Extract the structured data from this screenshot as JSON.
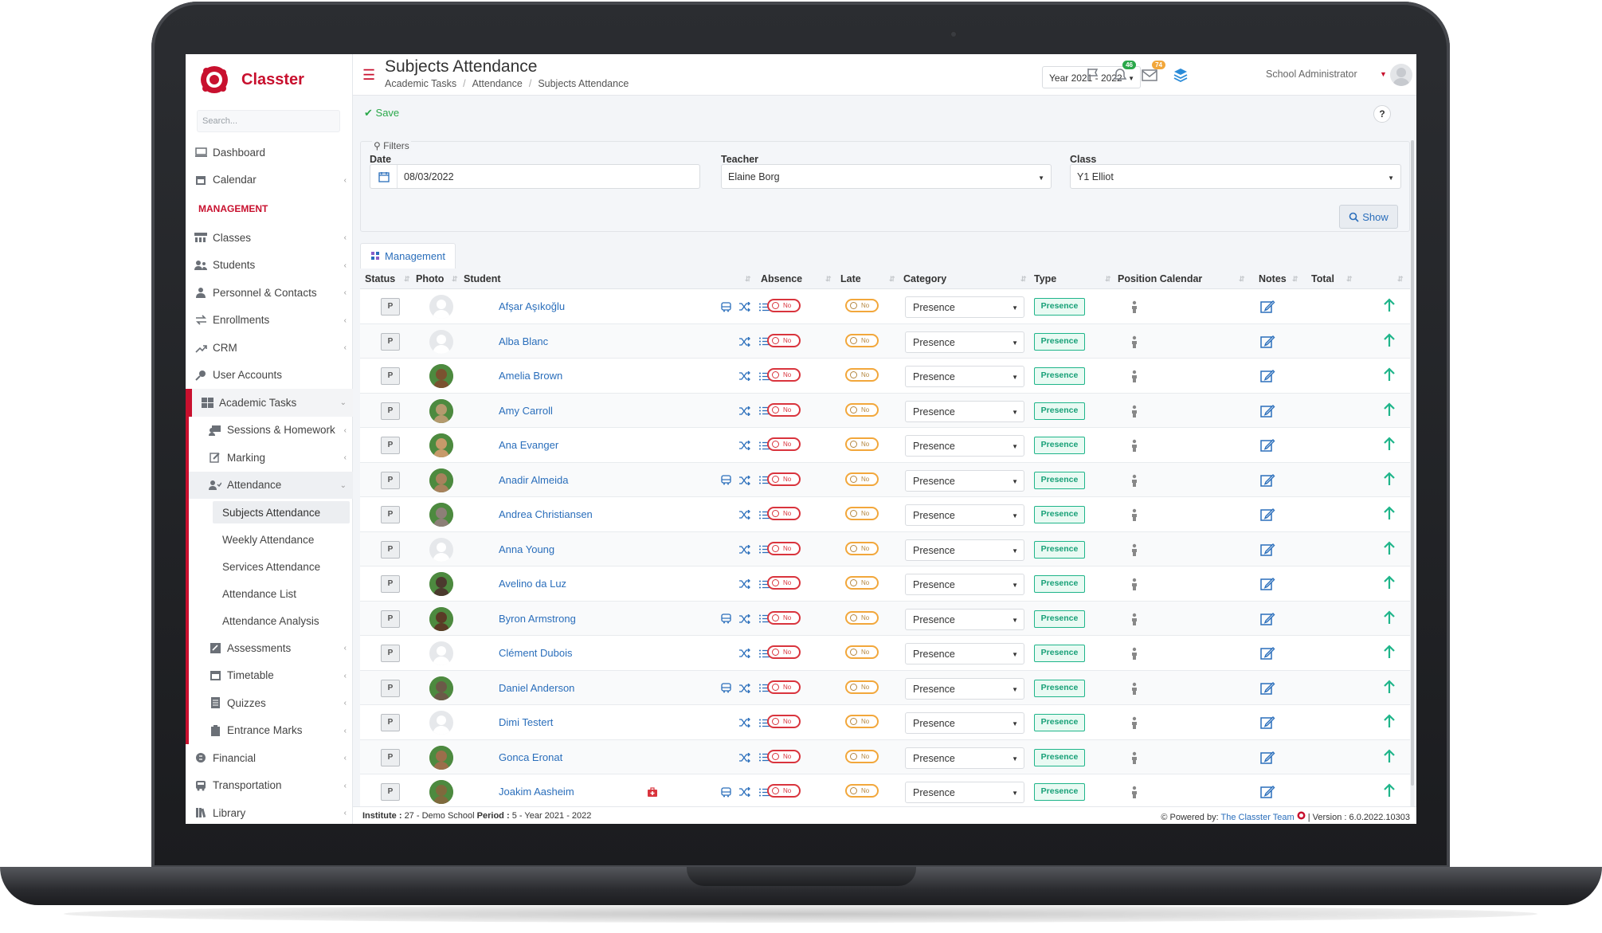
{
  "app": {
    "brand": "Classter",
    "brand_color": "#c8102e",
    "accent": "#2a6ebb"
  },
  "sidebar": {
    "search_placeholder": "Search...",
    "items_top": [
      {
        "label": "Dashboard",
        "icon": "monitor-icon"
      },
      {
        "label": "Calendar",
        "icon": "calendar-icon"
      }
    ],
    "section_title": "MANAGEMENT",
    "items_mgmt": [
      {
        "label": "Classes",
        "icon": "classes-icon"
      },
      {
        "label": "Students",
        "icon": "students-icon"
      },
      {
        "label": "Personnel & Contacts",
        "icon": "contacts-icon"
      },
      {
        "label": "Enrollments",
        "icon": "enrollments-icon"
      },
      {
        "label": "CRM",
        "icon": "crm-icon"
      },
      {
        "label": "User Accounts",
        "icon": "user-accounts-icon"
      }
    ],
    "academic_tasks": "Academic Tasks",
    "academic_sub": [
      {
        "label": "Sessions & Homework",
        "icon": "sessions-icon"
      },
      {
        "label": "Marking",
        "icon": "marking-icon"
      },
      {
        "label": "Attendance",
        "icon": "attendance-icon"
      }
    ],
    "attendance_sub": [
      "Subjects Attendance",
      "Weekly Attendance",
      "Services Attendance",
      "Attendance List",
      "Attendance Analysis"
    ],
    "academic_sub_after": [
      {
        "label": "Assessments",
        "icon": "assessments-icon"
      },
      {
        "label": "Timetable",
        "icon": "timetable-icon"
      },
      {
        "label": "Quizzes",
        "icon": "quizzes-icon"
      },
      {
        "label": "Entrance Marks",
        "icon": "entrance-marks-icon"
      }
    ],
    "items_bottom": [
      {
        "label": "Financial",
        "icon": "financial-icon"
      },
      {
        "label": "Transportation",
        "icon": "bus-icon"
      },
      {
        "label": "Library",
        "icon": "library-icon"
      }
    ]
  },
  "header": {
    "title": "Subjects Attendance",
    "breadcrumb": [
      "Academic Tasks",
      "Attendance",
      "Subjects Attendance"
    ],
    "year": "Year 2021 - 2022",
    "notifications_count": "46",
    "messages_count": "74",
    "user": "School Administrator"
  },
  "toolbar": {
    "save_label": "Save",
    "help_label": "?"
  },
  "filters": {
    "legend": "Filters",
    "date_label": "Date",
    "date_value": "08/03/2022",
    "teacher_label": "Teacher",
    "teacher_value": "Elaine Borg",
    "class_label": "Class",
    "class_value": "Y1 Elliot",
    "show_label": "Show"
  },
  "tab": {
    "label": "Management"
  },
  "table": {
    "columns": [
      "Status",
      "Photo",
      "Student",
      "Absence",
      "Late",
      "Category",
      "Type",
      "Position Calendar",
      "Notes",
      "Total"
    ],
    "status_label": "P",
    "toggle_label": "No",
    "category_value": "Presence",
    "type_value": "Presence",
    "rows": [
      {
        "name": "Afşar Aşıkoğlu",
        "bus": true,
        "medical": false,
        "photo": "placeholder"
      },
      {
        "name": "Alba Blanc",
        "bus": false,
        "medical": false,
        "photo": "placeholder"
      },
      {
        "name": "Amelia Brown",
        "bus": false,
        "medical": false,
        "photo": "#7a5230"
      },
      {
        "name": "Amy Carroll",
        "bus": false,
        "medical": false,
        "photo": "#b49a6e"
      },
      {
        "name": "Ana Evanger",
        "bus": false,
        "medical": false,
        "photo": "#c79a6a"
      },
      {
        "name": "Anadir Almeida",
        "bus": true,
        "medical": false,
        "photo": "#a8825d"
      },
      {
        "name": "Andrea Christiansen",
        "bus": false,
        "medical": false,
        "photo": "#8c7f77"
      },
      {
        "name": "Anna Young",
        "bus": false,
        "medical": false,
        "photo": "placeholder"
      },
      {
        "name": "Avelino da Luz",
        "bus": false,
        "medical": false,
        "photo": "#4b3a2e"
      },
      {
        "name": "Byron Armstrong",
        "bus": true,
        "medical": false,
        "photo": "#5a3b26"
      },
      {
        "name": "Clément Dubois",
        "bus": false,
        "medical": false,
        "photo": "placeholder"
      },
      {
        "name": "Daniel Anderson",
        "bus": true,
        "medical": false,
        "photo": "#6b5a48"
      },
      {
        "name": "Dimi Testert",
        "bus": false,
        "medical": false,
        "photo": "placeholder"
      },
      {
        "name": "Gonca Eronat",
        "bus": false,
        "medical": false,
        "photo": "#9b6e4b"
      },
      {
        "name": "Joakim Aasheim",
        "bus": true,
        "medical": true,
        "photo": "#7f6a3d"
      }
    ]
  },
  "footer": {
    "institute_label": "Institute :",
    "institute_value": "27 - Demo School",
    "period_label": "Period :",
    "period_value": "5 - Year 2021 - 2022",
    "powered_label": "Powered by:",
    "powered_link": "The Classter Team",
    "version": "| Version : 6.0.2022.10303"
  }
}
